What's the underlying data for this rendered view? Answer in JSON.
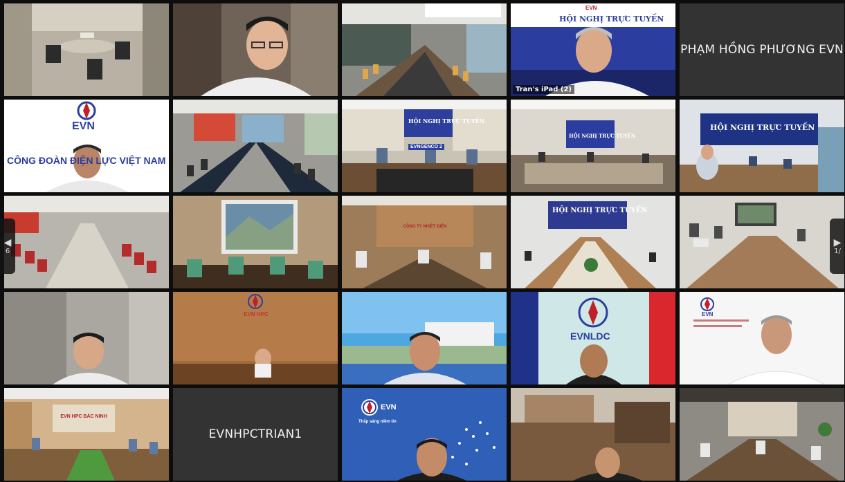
{
  "navigation": {
    "prev_page": "6",
    "next_page": "1/"
  },
  "tiles": [
    {
      "type": "video",
      "scene": "empty-office"
    },
    {
      "type": "video",
      "scene": "man-glasses"
    },
    {
      "type": "video",
      "scene": "meeting-room-wide"
    },
    {
      "type": "video",
      "scene": "man-ipad",
      "label": "Tran's iPad (2)",
      "banner": "HỘI NGHỊ TRỰC TUYẾN",
      "logo": "EVN",
      "active": true
    },
    {
      "type": "name",
      "name": "PHẠM HỒNG PHƯƠNG EVN"
    },
    {
      "type": "video",
      "scene": "evn-union",
      "logo": "EVN",
      "banner": "CÔNG ĐOÀN ĐIỆN LỰC VIỆT NAM"
    },
    {
      "type": "video",
      "scene": "conference-long-table"
    },
    {
      "type": "video",
      "scene": "genco-room",
      "banner": "HỘI NGHỊ TRỰC TUYẾN",
      "sign": "EVNGENCO 2"
    },
    {
      "type": "video",
      "scene": "blue-wall-room",
      "banner": "HỘI NGHỊ TRỰC TUYẾN"
    },
    {
      "type": "video",
      "scene": "blue-wall-room-2",
      "banner": "HỘI NGHỊ TRỰC TUYẾN"
    },
    {
      "type": "video",
      "scene": "red-chair-room"
    },
    {
      "type": "video",
      "scene": "projector-room"
    },
    {
      "type": "video",
      "scene": "wood-wall-room",
      "sign": "CÔNG TY NHIỆT ĐIỆN"
    },
    {
      "type": "video",
      "scene": "banner-room",
      "banner": "HỘI NGHỊ TRỰC TUYẾN"
    },
    {
      "type": "video",
      "scene": "laptop-room"
    },
    {
      "type": "video",
      "scene": "man-side"
    },
    {
      "type": "video",
      "scene": "hpc-wall",
      "sign": "EVN HPC"
    },
    {
      "type": "video",
      "scene": "man-building-bg"
    },
    {
      "type": "video",
      "scene": "evndc-room",
      "sign": "EVNLDC"
    },
    {
      "type": "video",
      "scene": "evn-telecom",
      "sign": "EVN"
    },
    {
      "type": "video",
      "scene": "hpc-bac-ninh",
      "sign": "EVN HPC BẮC NINH"
    },
    {
      "type": "name",
      "name": "EVNHPCTRIAN1"
    },
    {
      "type": "video",
      "scene": "evn-blue-poster",
      "logo": "EVN",
      "sign": "Thắp sáng niềm tin"
    },
    {
      "type": "video",
      "scene": "man-room"
    },
    {
      "type": "video",
      "scene": "meeting-room-back"
    }
  ]
}
